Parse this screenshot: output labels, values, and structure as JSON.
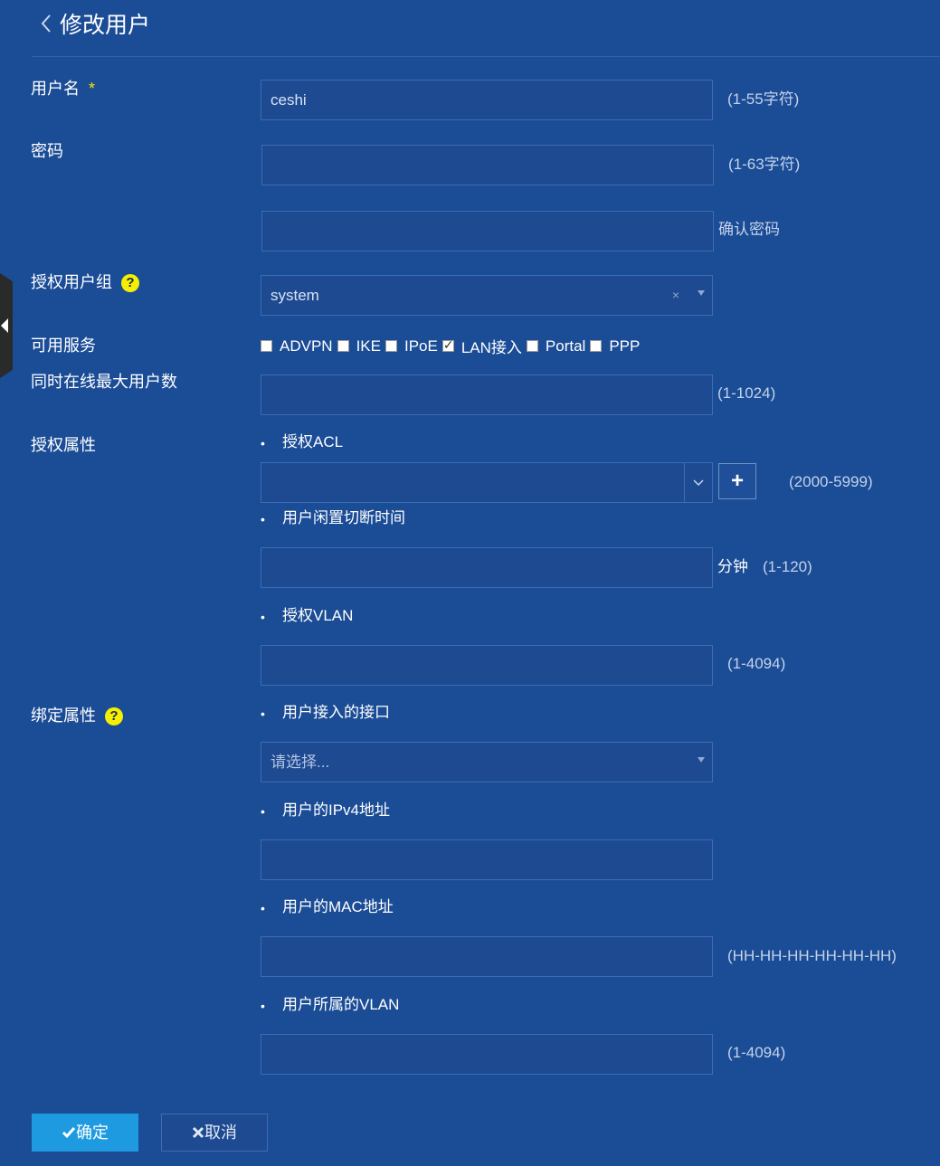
{
  "header": {
    "title": "修改用户"
  },
  "form": {
    "username": {
      "label": "用户名",
      "required_mark": "*",
      "value": "ceshi",
      "hint": "(1-55字符)"
    },
    "password": {
      "label": "密码",
      "value": "",
      "hint": "(1-63字符)",
      "confirm_hint": "确认密码"
    },
    "auth_group": {
      "label": "授权用户组",
      "help": "?",
      "value": "system",
      "clear": "×"
    },
    "services": {
      "label": "可用服务",
      "items": [
        {
          "label": "ADVPN",
          "checked": false
        },
        {
          "label": "IKE",
          "checked": false
        },
        {
          "label": "IPoE",
          "checked": false
        },
        {
          "label": "LAN接入",
          "checked": true
        },
        {
          "label": "Portal",
          "checked": false
        },
        {
          "label": "PPP",
          "checked": false
        }
      ]
    },
    "max_users": {
      "label": "同时在线最大用户数",
      "value": "",
      "hint": "(1-1024)"
    },
    "auth_attrs": {
      "label": "授权属性",
      "acl": {
        "label": "授权ACL",
        "value": "",
        "add_button": "+",
        "hint": "(2000-5999)"
      },
      "idle": {
        "label": "用户闲置切断时间",
        "value": "",
        "unit": "分钟",
        "hint": "(1-120)"
      },
      "vlan": {
        "label": "授权VLAN",
        "value": "",
        "hint": "(1-4094)"
      }
    },
    "bind_attrs": {
      "label": "绑定属性",
      "help": "?",
      "interface": {
        "label": "用户接入的接口",
        "placeholder": "请选择..."
      },
      "ipv4": {
        "label": "用户的IPv4地址",
        "value": ""
      },
      "mac": {
        "label": "用户的MAC地址",
        "value": "",
        "hint": "(HH-HH-HH-HH-HH-HH)"
      },
      "user_vlan": {
        "label": "用户所属的VLAN",
        "value": "",
        "hint": "(1-4094)"
      }
    }
  },
  "buttons": {
    "ok": "确定",
    "cancel": "取消"
  },
  "colors": {
    "background": "#1b4c96",
    "field": "#1d4a91",
    "primary": "#1e9be0",
    "help": "#f5ef00"
  }
}
